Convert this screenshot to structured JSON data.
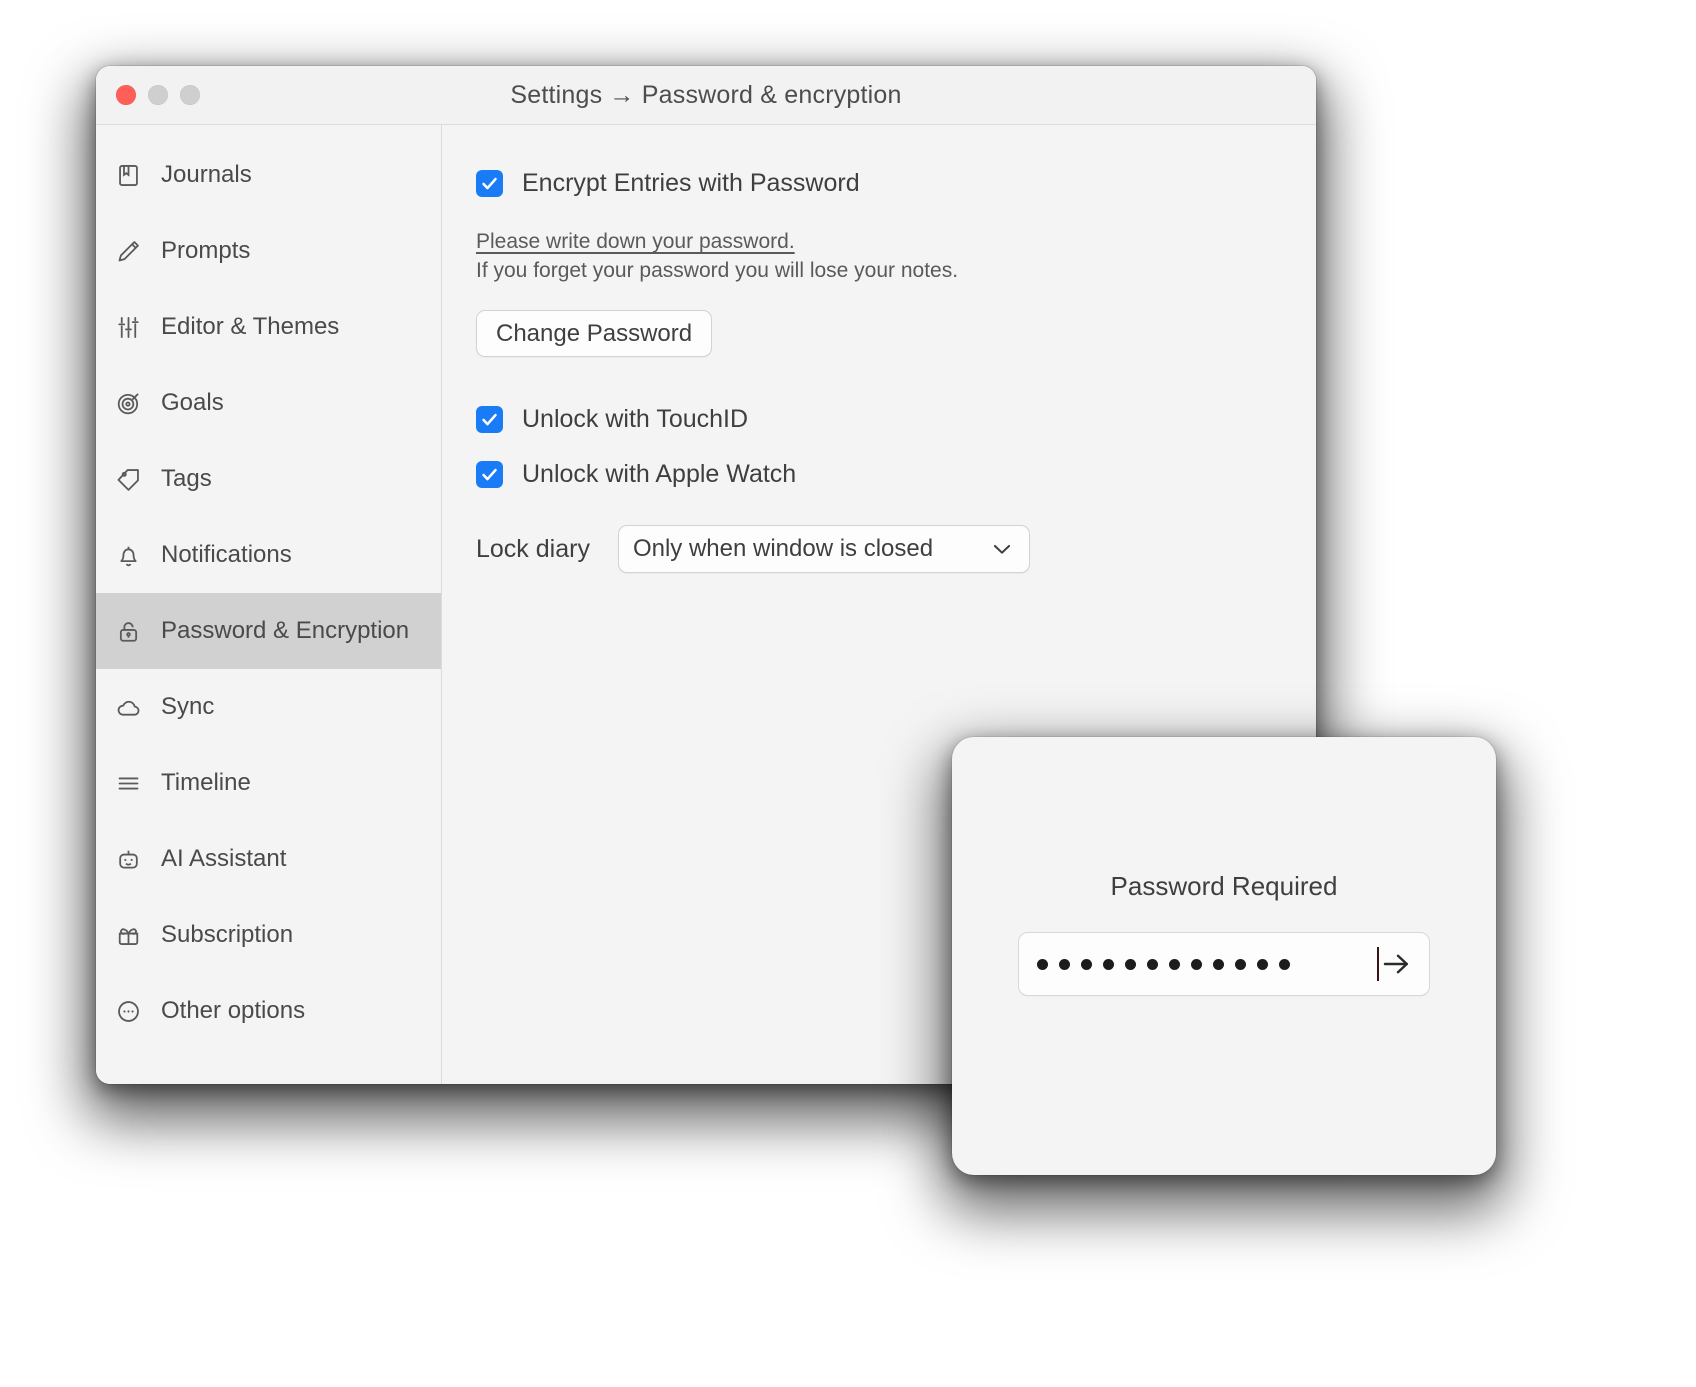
{
  "window": {
    "title": "Settings → Password & encryption",
    "traffic_lights": [
      "close",
      "minimize",
      "zoom"
    ]
  },
  "sidebar": {
    "items": [
      {
        "label": "Journals",
        "icon": "journal-icon",
        "active": false
      },
      {
        "label": "Prompts",
        "icon": "pencil-icon",
        "active": false
      },
      {
        "label": "Editor & Themes",
        "icon": "sliders-icon",
        "active": false
      },
      {
        "label": "Goals",
        "icon": "target-icon",
        "active": false
      },
      {
        "label": "Tags",
        "icon": "tag-icon",
        "active": false
      },
      {
        "label": "Notifications",
        "icon": "bell-icon",
        "active": false
      },
      {
        "label": "Password & Encryption",
        "icon": "lock-icon",
        "active": true
      },
      {
        "label": "Sync",
        "icon": "cloud-icon",
        "active": false
      },
      {
        "label": "Timeline",
        "icon": "list-lines-icon",
        "active": false
      },
      {
        "label": "AI Assistant",
        "icon": "robot-icon",
        "active": false
      },
      {
        "label": "Subscription",
        "icon": "gift-icon",
        "active": false
      },
      {
        "label": "Other options",
        "icon": "ellipsis-circle-icon",
        "active": false
      }
    ]
  },
  "main": {
    "encrypt_checkbox": {
      "label": "Encrypt Entries with Password",
      "checked": true
    },
    "warning": {
      "line1": "Please write down your password.",
      "line2": "If you forget your password you will lose your notes."
    },
    "change_password_button": "Change Password",
    "touchid_checkbox": {
      "label": "Unlock with TouchID",
      "checked": true
    },
    "applewatch_checkbox": {
      "label": "Unlock with Apple Watch",
      "checked": true
    },
    "lock_diary": {
      "label": "Lock diary",
      "selected": "Only when window is closed"
    }
  },
  "dialog": {
    "title": "Password Required",
    "password_dot_count": 12,
    "submit_icon": "arrow-right-icon"
  },
  "colors": {
    "accent_checkbox": "#1a7bf7",
    "close_button": "#ff5f57",
    "sidebar_active_bg": "#d1d1d1",
    "window_bg": "#f4f4f4"
  }
}
